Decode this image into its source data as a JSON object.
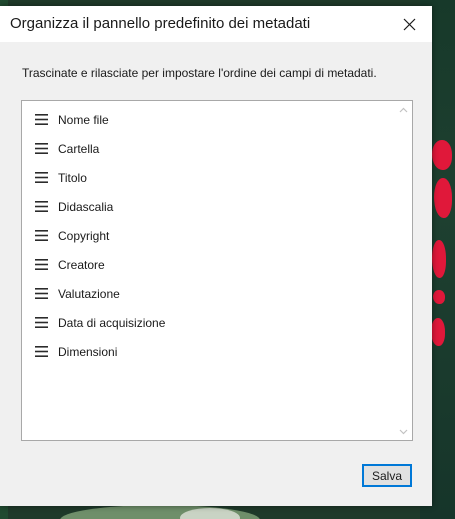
{
  "dialog": {
    "title": "Organizza il pannello predefinito dei metadati",
    "instruction": "Trascinate e rilasciate per impostare l'ordine dei campi di metadati.",
    "close_icon": "close-icon",
    "save_label": "Salva"
  },
  "fields": [
    {
      "label": "Nome file"
    },
    {
      "label": "Cartella"
    },
    {
      "label": "Titolo"
    },
    {
      "label": "Didascalia"
    },
    {
      "label": "Copyright"
    },
    {
      "label": "Creatore"
    },
    {
      "label": "Valutazione"
    },
    {
      "label": "Data di acquisizione"
    },
    {
      "label": "Dimensioni"
    }
  ],
  "colors": {
    "dialog_bg": "#f0f0f0",
    "titlebar_bg": "#ffffff",
    "accent": "#0078d7",
    "text": "#1a1a1a",
    "list_border": "#a8a8a8"
  }
}
